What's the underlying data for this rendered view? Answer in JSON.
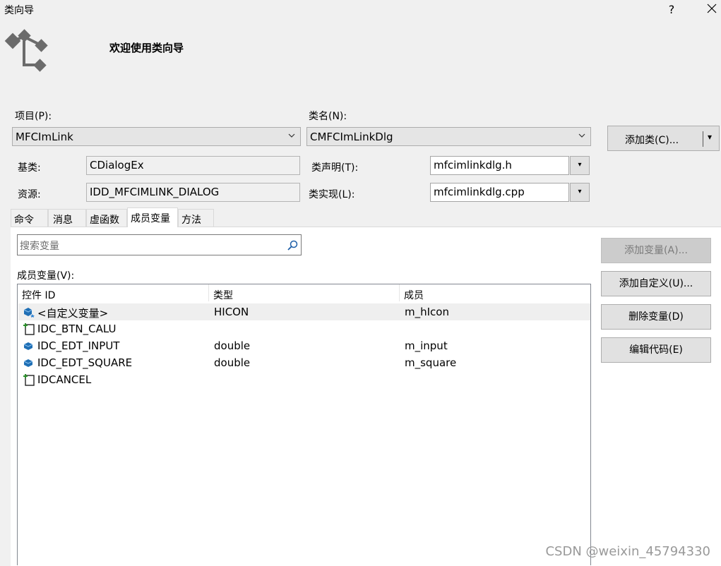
{
  "window": {
    "title": "类向导",
    "help_label": "?",
    "close_label": "✕"
  },
  "banner": {
    "title": "欢迎使用类向导",
    "logo_icon": "class-wizard-logo-icon"
  },
  "project": {
    "label": "项目(P):",
    "value": "MFCImLink"
  },
  "classname": {
    "label": "类名(N):",
    "value": "CMFCImLinkDlg"
  },
  "add_class_button": {
    "label": "添加类(C)...",
    "arrow": "▾"
  },
  "base_class": {
    "label": "基类:",
    "value": "CDialogEx"
  },
  "resource": {
    "label": "资源:",
    "value": "IDD_MFCIMLINK_DIALOG"
  },
  "class_decl": {
    "label": "类声明(T):",
    "value": "mfcimlinkdlg.h"
  },
  "class_impl": {
    "label": "类实现(L):",
    "value": "mfcimlinkdlg.cpp"
  },
  "tabs": [
    {
      "label": "命令",
      "active": false
    },
    {
      "label": "消息",
      "active": false
    },
    {
      "label": "虚函数",
      "active": false
    },
    {
      "label": "成员变量",
      "active": true
    },
    {
      "label": "方法",
      "active": false
    }
  ],
  "search": {
    "placeholder": "搜索变量",
    "icon": "search-icon"
  },
  "members_label": "成员变量(V):",
  "table": {
    "columns": [
      "控件 ID",
      "类型",
      "成员"
    ],
    "rows": [
      {
        "icon": "custom-variable-icon",
        "id": "<自定义变量>",
        "type": "HICON",
        "member": "m_hIcon"
      },
      {
        "icon": "button-control-icon",
        "id": "IDC_BTN_CALU",
        "type": "",
        "member": ""
      },
      {
        "icon": "edit-variable-icon",
        "id": "IDC_EDT_INPUT",
        "type": "double",
        "member": "m_input"
      },
      {
        "icon": "edit-variable-icon",
        "id": "IDC_EDT_SQUARE",
        "type": "double",
        "member": "m_square"
      },
      {
        "icon": "button-control-icon",
        "id": "IDCANCEL",
        "type": "",
        "member": ""
      }
    ]
  },
  "side_buttons": {
    "add_variable": "添加变量(A)...",
    "add_custom": "添加自定义(U)...",
    "delete_variable": "删除变量(D)",
    "edit_code": "编辑代码(E)"
  },
  "watermark": "CSDN @weixin_45794330"
}
